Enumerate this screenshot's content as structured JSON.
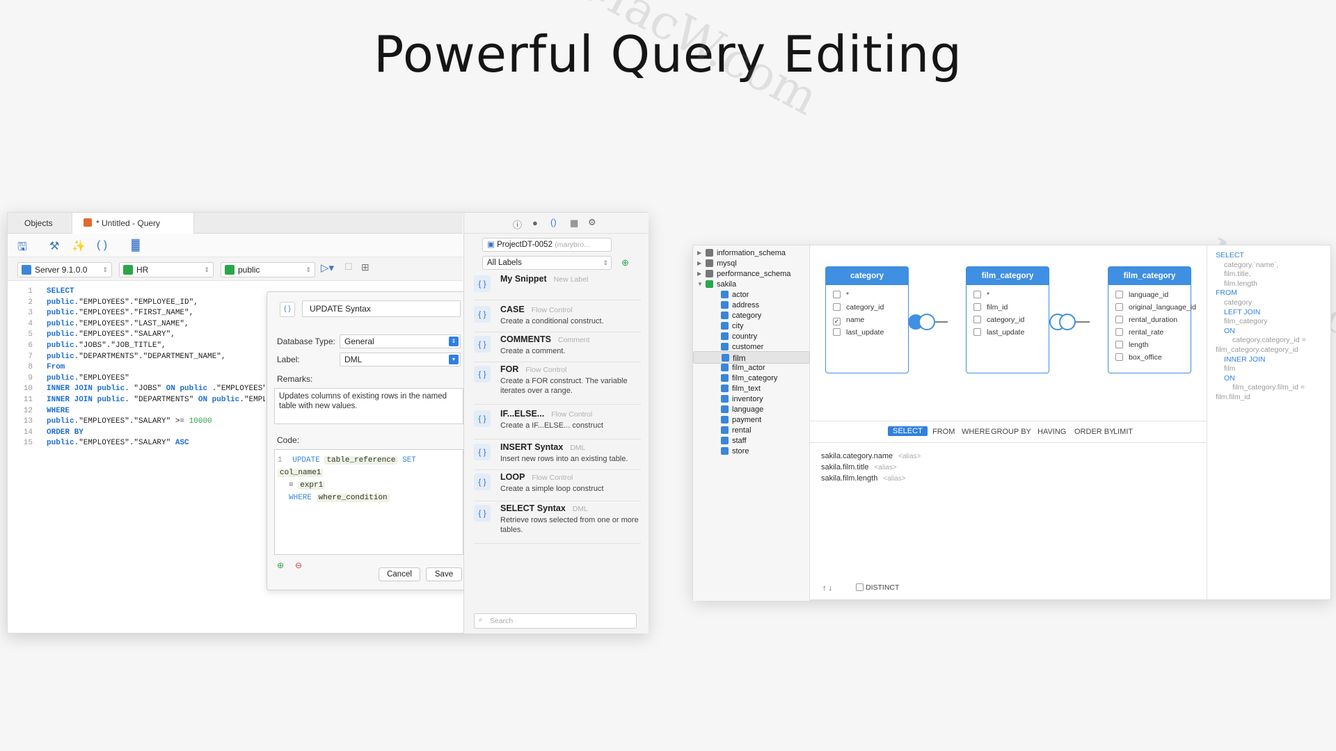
{
  "hero": {
    "title": "Powerful Query Editing"
  },
  "left_window": {
    "tabs": [
      {
        "label": "Objects"
      },
      {
        "label": "* Untitled - Query"
      }
    ],
    "toolbar2": {
      "server": "Server 9.1.0.0",
      "database": "HR",
      "schema": "public"
    },
    "code_lines": [
      {
        "n": "1",
        "html": "<span class='kw'>SELECT</span>"
      },
      {
        "n": "2",
        "html": "<span class='kw'>public</span>.\"EMPLOYEES\".\"EMPLOYEE_ID\","
      },
      {
        "n": "3",
        "html": "<span class='kw'>public</span>.\"EMPLOYEES\".\"FIRST_NAME\","
      },
      {
        "n": "4",
        "html": "<span class='kw'>public</span>.\"EMPLOYEES\".\"LAST_NAME\","
      },
      {
        "n": "5",
        "html": "<span class='kw'>public</span>.\"EMPLOYEES\".\"SALARY\","
      },
      {
        "n": "6",
        "html": "<span class='kw'>public</span>.\"JOBS\".\"JOB_TITLE\","
      },
      {
        "n": "7",
        "html": "<span class='kw'>public</span>.\"DEPARTMENTS\".\"DEPARTMENT_NAME\","
      },
      {
        "n": "8",
        "html": "<span class='kw'>From</span>"
      },
      {
        "n": "9",
        "html": "<span class='kw'>public</span>.\"EMPLOYEES\""
      },
      {
        "n": "10",
        "html": "<span class='kw'>INNER JOIN public</span>. \"JOBS\" <span class='kw'>ON public</span> .\"EMPLOYEES\".\"JOB_ID\""
      },
      {
        "n": "11",
        "html": "<span class='kw'>INNER JOIN public</span>. \"DEPARTMENTS\" <span class='kw'>ON public</span>.\"EMPLOYEES\""
      },
      {
        "n": "12",
        "html": "<span class='kw'>WHERE</span>"
      },
      {
        "n": "13",
        "html": "<span class='kw'>public</span>.\"EMPLOYEES\".\"SALARY\" >= <span class='num'>10000</span>"
      },
      {
        "n": "14",
        "html": "<span class='kw'>ORDER BY</span>"
      },
      {
        "n": "15",
        "html": "<span class='kw'>public</span>.\"EMPLOYEES\".\"SALARY\" <span class='kw'>ASC</span>"
      }
    ],
    "dialog": {
      "name": "UPDATE Syntax",
      "db_type_label": "Database Type:",
      "db_type_value": "General",
      "label_label": "Label:",
      "label_value": "DML",
      "remarks_label": "Remarks:",
      "remarks_value": "Updates columns of existing rows in the named table with new values.",
      "code_label": "Code:",
      "code_line_no": "1",
      "code_update": "UPDATE",
      "code_table": "table_reference",
      "code_set": "SET",
      "code_col": "col_name1",
      "code_eq": "=",
      "code_expr": "expr1",
      "code_where": "WHERE",
      "code_cond": "where_condition",
      "cancel": "Cancel",
      "save": "Save"
    },
    "snippets_panel": {
      "project": "ProjectDT-0052",
      "project_user": "(marybro...",
      "labels": "All Labels",
      "search_placeholder": "Search",
      "items": [
        {
          "title": "My Snippet",
          "category": "New Label",
          "desc": ""
        },
        {
          "title": "CASE",
          "category": "Flow Control",
          "desc": "Create a conditional construct."
        },
        {
          "title": "COMMENTS",
          "category": "Comment",
          "desc": "Create a comment."
        },
        {
          "title": "FOR",
          "category": "Flow Control",
          "desc": "Create a FOR construct. The variable iterates over a range."
        },
        {
          "title": "IF...ELSE...",
          "category": "Flow Control",
          "desc": "Create a IF...ELSE... construct"
        },
        {
          "title": "INSERT Syntax",
          "category": "DML",
          "desc": "Insert new rows into an existing table."
        },
        {
          "title": "LOOP",
          "category": "Flow Control",
          "desc": "Create a simple loop construct"
        },
        {
          "title": "SELECT Syntax",
          "category": "DML",
          "desc": "Retrieve rows selected from one or more tables."
        }
      ]
    }
  },
  "right_window": {
    "tree": [
      {
        "label": "information_schema",
        "level": 0,
        "twisty": "▶"
      },
      {
        "label": "mysql",
        "level": 0,
        "twisty": "▶"
      },
      {
        "label": "performance_schema",
        "level": 0,
        "twisty": "▶"
      },
      {
        "label": "sakila",
        "level": 0,
        "twisty": "▼"
      },
      {
        "label": "actor",
        "level": 1
      },
      {
        "label": "address",
        "level": 1
      },
      {
        "label": "category",
        "level": 1
      },
      {
        "label": "city",
        "level": 1
      },
      {
        "label": "country",
        "level": 1
      },
      {
        "label": "customer",
        "level": 1
      },
      {
        "label": "film",
        "level": 1,
        "selected": true
      },
      {
        "label": "film_actor",
        "level": 1
      },
      {
        "label": "film_category",
        "level": 1
      },
      {
        "label": "film_text",
        "level": 1
      },
      {
        "label": "inventory",
        "level": 1
      },
      {
        "label": "language",
        "level": 1
      },
      {
        "label": "payment",
        "level": 1
      },
      {
        "label": "rental",
        "level": 1
      },
      {
        "label": "staff",
        "level": 1
      },
      {
        "label": "store",
        "level": 1
      }
    ],
    "entities": [
      {
        "name": "category",
        "fields": [
          {
            "n": "*",
            "c": false
          },
          {
            "n": "category_id",
            "c": false
          },
          {
            "n": "name",
            "c": true
          },
          {
            "n": "last_update",
            "c": false
          }
        ]
      },
      {
        "name": "film_category",
        "fields": [
          {
            "n": "*",
            "c": false
          },
          {
            "n": "film_id",
            "c": false
          },
          {
            "n": "category_id",
            "c": false
          },
          {
            "n": "last_update",
            "c": false
          }
        ]
      },
      {
        "name": "film_category",
        "fields": [
          {
            "n": "language_id",
            "c": false
          },
          {
            "n": "original_language_id",
            "c": false
          },
          {
            "n": "rental_duration",
            "c": false
          },
          {
            "n": "rental_rate",
            "c": false
          },
          {
            "n": "length",
            "c": false
          },
          {
            "n": "box_office",
            "c": false
          }
        ]
      }
    ],
    "clauses": [
      "SELECT",
      "FROM",
      "WHERE",
      "GROUP BY",
      "HAVING",
      "ORDER BY",
      "LIMIT"
    ],
    "select_fields": [
      {
        "field": "sakila.category.name",
        "alias": "<alias>"
      },
      {
        "field": "sakila.film.title",
        "alias": "<alias>"
      },
      {
        "field": "sakila.film.length",
        "alias": "<alias>"
      }
    ],
    "arrows": "↑ ↓",
    "distinct": "DISTINCT",
    "sql_preview": [
      {
        "t": "SELECT",
        "kw": true,
        "i": 0
      },
      {
        "t": "category.`name`,",
        "kw": false,
        "i": 1
      },
      {
        "t": "film.title,",
        "kw": false,
        "i": 1
      },
      {
        "t": "film.length",
        "kw": false,
        "i": 1
      },
      {
        "t": "FROM",
        "kw": true,
        "i": 0
      },
      {
        "t": "category",
        "kw": false,
        "i": 1
      },
      {
        "t": "LEFT JOIN",
        "kw": true,
        "i": 1
      },
      {
        "t": "film_category",
        "kw": false,
        "i": 1
      },
      {
        "t": "ON",
        "kw": true,
        "i": 1
      },
      {
        "t": "category.category_id =",
        "kw": false,
        "i": 2
      },
      {
        "t": "film_category.category_id",
        "kw": false,
        "i": 0
      },
      {
        "t": "INNER JOIN",
        "kw": true,
        "i": 1
      },
      {
        "t": "film",
        "kw": false,
        "i": 1
      },
      {
        "t": "ON",
        "kw": true,
        "i": 1
      },
      {
        "t": "film_category.film_id =",
        "kw": false,
        "i": 2
      },
      {
        "t": "film.film_id",
        "kw": false,
        "i": 0
      }
    ]
  },
  "watermark": "MacW.com"
}
